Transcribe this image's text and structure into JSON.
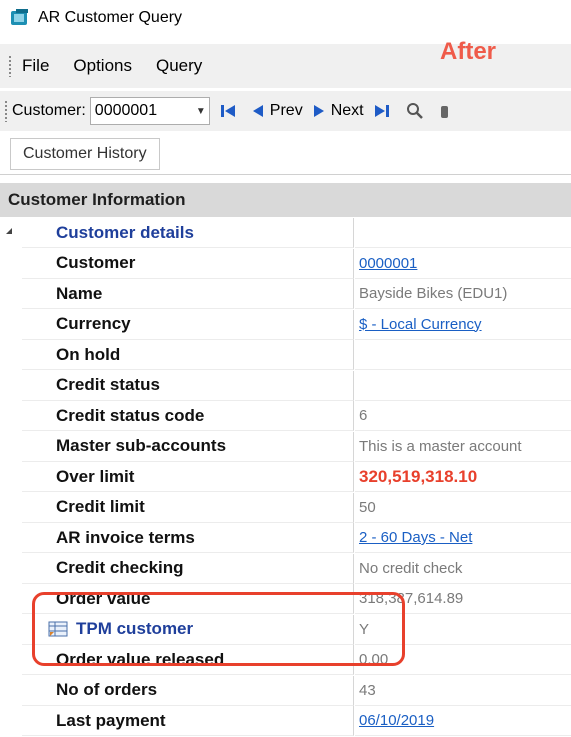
{
  "window": {
    "title": "AR Customer Query"
  },
  "annotation": {
    "after_label": "After"
  },
  "menu": {
    "items": [
      "File",
      "Options",
      "Query"
    ]
  },
  "toolbar": {
    "customer_label": "Customer:",
    "customer_value": "0000001",
    "prev_label": "Prev",
    "next_label": "Next"
  },
  "tabs": [
    "Customer History"
  ],
  "section": {
    "title": "Customer Information"
  },
  "group": {
    "title": "Customer details"
  },
  "rows": [
    {
      "label": "Customer",
      "value": "0000001"
    },
    {
      "label": "Name",
      "value": "Bayside Bikes (EDU1)"
    },
    {
      "label": "Currency",
      "value": "$ - Local Currency"
    },
    {
      "label": "On hold",
      "value": ""
    },
    {
      "label": "Credit status",
      "value": ""
    },
    {
      "label": "Credit status code",
      "value": "6"
    },
    {
      "label": "Master sub-accounts",
      "value": "This is a master account"
    },
    {
      "label": "Over limit",
      "value": "320,519,318.10"
    },
    {
      "label": "Credit limit",
      "value": "50"
    },
    {
      "label": "AR invoice terms",
      "value": "2 - 60 Days - Net"
    },
    {
      "label": "Credit checking",
      "value": "No credit check"
    },
    {
      "label": "Order value",
      "value": "318,387,614.89"
    },
    {
      "label": "TPM customer",
      "value": "Y"
    },
    {
      "label": "Order value released",
      "value": "0.00"
    },
    {
      "label": "No of orders",
      "value": "43"
    },
    {
      "label": "Last payment",
      "value": "06/10/2019"
    }
  ],
  "colors": {
    "accent_red": "#e8402c",
    "link_blue": "#1a5fc4",
    "group_blue": "#1f3f9b"
  }
}
